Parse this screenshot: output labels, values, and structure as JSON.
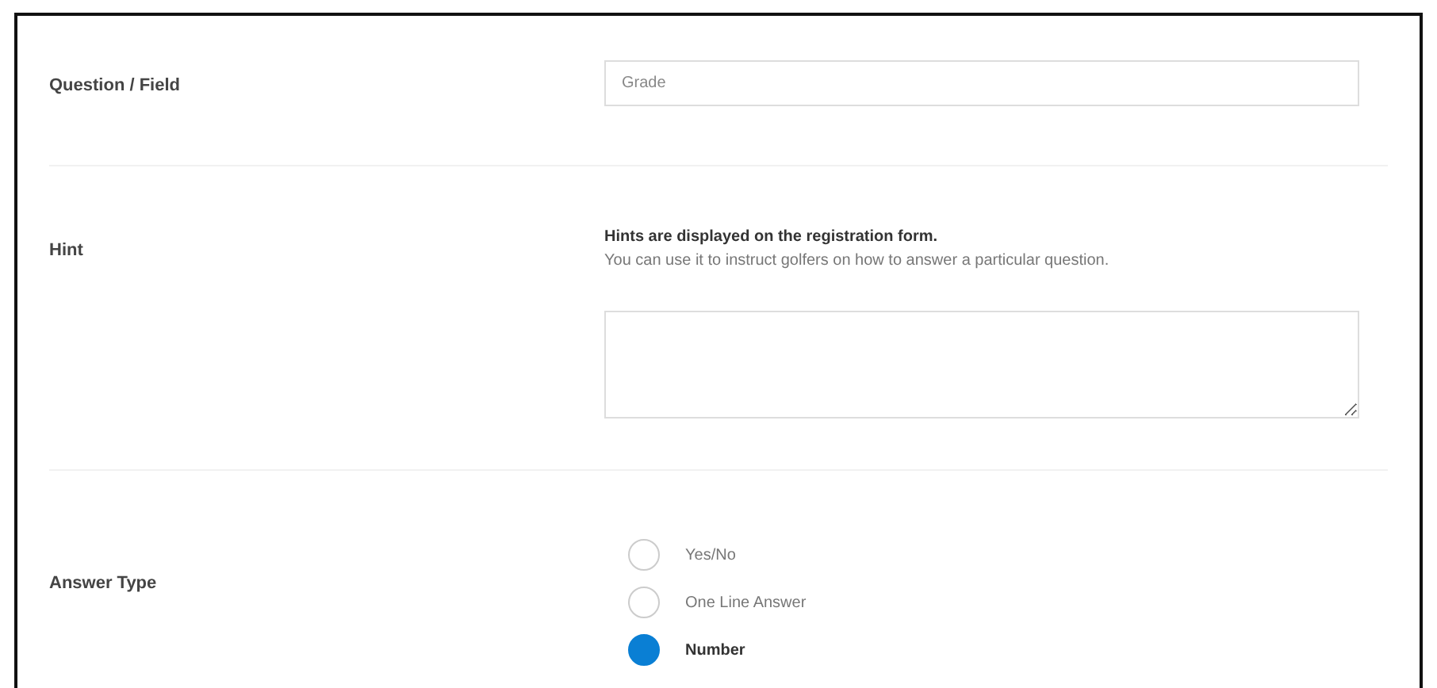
{
  "fields": [
    {
      "kind": "text",
      "label": "Question / Field",
      "value": "Grade"
    },
    {
      "kind": "textarea",
      "label": "Hint",
      "note_title": "Hints are displayed on the registration form.",
      "note": "You can use it to instruct golfers on how to answer a particular question."
    },
    {
      "kind": "radios",
      "label": "Answer Type",
      "options": [
        {
          "label": "Yes/No",
          "selected": false
        },
        {
          "label": "One Line Answer",
          "selected": false
        },
        {
          "label": "Number",
          "selected": true
        }
      ]
    }
  ]
}
